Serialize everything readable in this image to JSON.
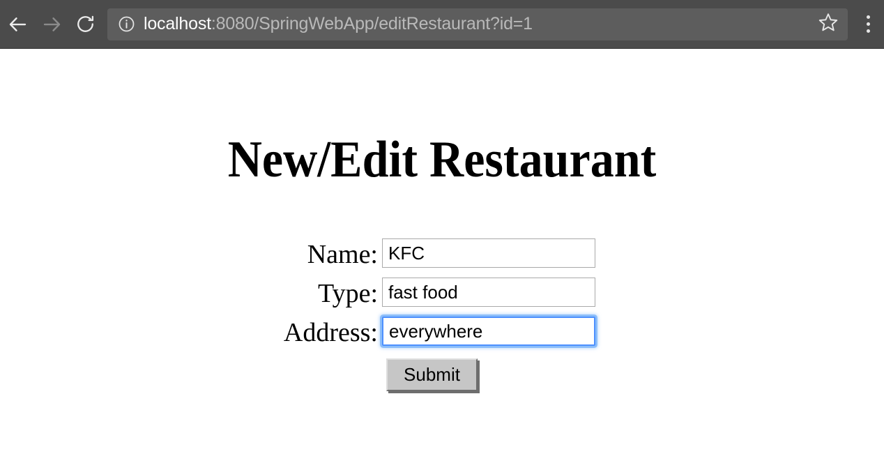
{
  "browser": {
    "back_icon": "back-arrow-icon",
    "forward_icon": "forward-arrow-icon",
    "reload_icon": "reload-icon",
    "page_info_icon": "info-circle-icon",
    "bookmark_icon": "star-outline-icon",
    "menu_icon": "three-dot-menu-icon",
    "url_host": "localhost",
    "url_rest": ":8080/SpringWebApp/editRestaurant?id=1",
    "url_full": "localhost:8080/SpringWebApp/editRestaurant?id=1",
    "colors": {
      "toolbar_bg": "#4b4b4b",
      "omnibox_bg": "#5d5d5d",
      "url_host_text": "#fdfdfd",
      "url_rest_text": "#b9b9b9",
      "icon": "#e6e6e6",
      "icon_disabled": "#8b8b8b"
    }
  },
  "page": {
    "title": "New/Edit Restaurant",
    "form": {
      "fields": [
        {
          "label": "Name:",
          "value": "KFC",
          "focused": false
        },
        {
          "label": "Type:",
          "value": "fast food",
          "focused": false
        },
        {
          "label": "Address:",
          "value": "everywhere",
          "focused": true
        }
      ],
      "submit_label": "Submit"
    },
    "colors": {
      "background": "#ffffff",
      "text": "#000000",
      "input_border": "#a9a9a9",
      "focus_ring": "#4d90fe",
      "button_face": "#c6c6c6",
      "button_shadow": "#6e6e6e"
    }
  }
}
